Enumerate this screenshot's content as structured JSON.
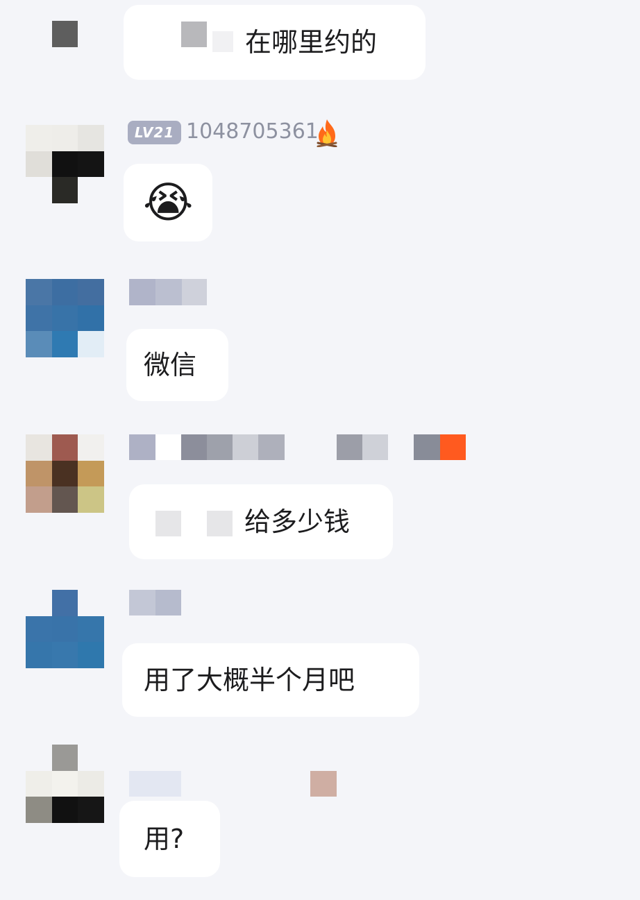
{
  "messages": [
    {
      "id": "m1",
      "text": "在哪里约的"
    },
    {
      "id": "m2",
      "level": "LV21",
      "username": "1048705361",
      "badge_icon": "fire-icon",
      "emoji": "😭"
    },
    {
      "id": "m3",
      "text": "微信"
    },
    {
      "id": "m4",
      "text": "给多少钱"
    },
    {
      "id": "m5",
      "text": "用了大概半个月吧"
    },
    {
      "id": "m6",
      "text": "用?"
    }
  ],
  "colors": {
    "background": "#f4f5f9",
    "bubble": "#ffffff",
    "text": "#1c1c1e",
    "nickname": "#8d91a0",
    "level_badge": "#a9adc1",
    "accent_badge": "#ff5a1f"
  }
}
